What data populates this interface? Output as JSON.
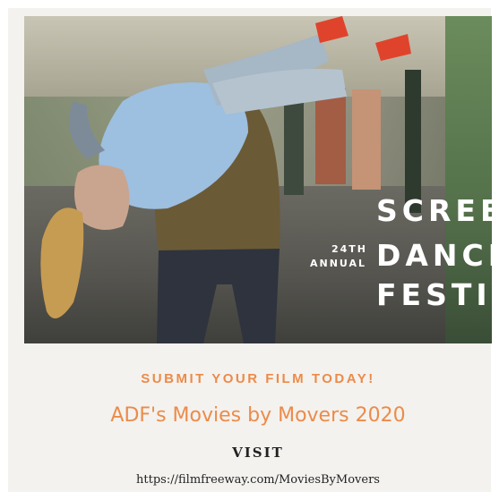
{
  "poster": {
    "festival": {
      "edition_number": "24TH",
      "edition_word": "ANNUAL",
      "line1": "SCREEN",
      "line2": "DANCE",
      "line3": "FESTIVAL",
      "text_color": "#ffffff"
    },
    "cta": "SUBMIT YOUR FILM TODAY!",
    "headline": "ADF's Movies by Movers 2020",
    "visit_label": "VISIT",
    "url": "https://filmfreeway.com/MoviesByMovers",
    "accent_color": "#ec8b49"
  }
}
